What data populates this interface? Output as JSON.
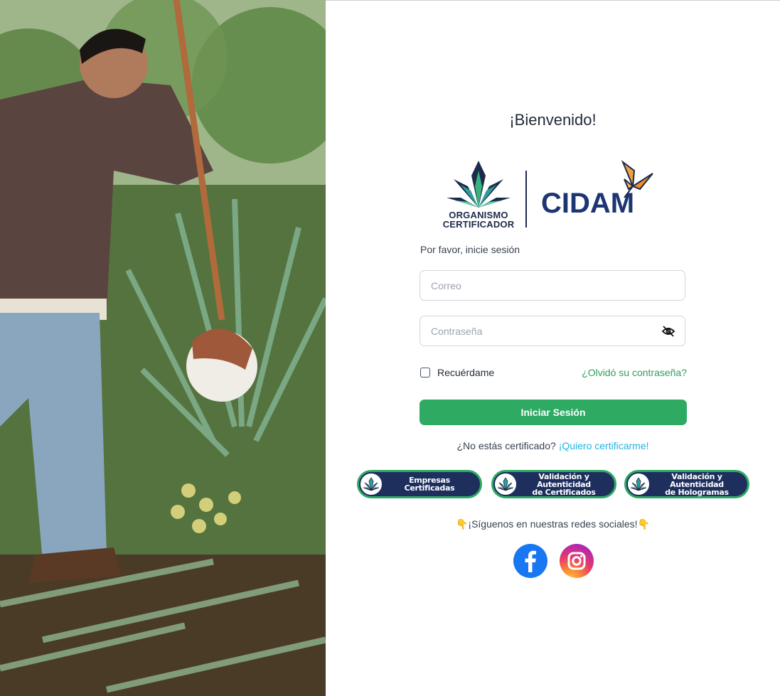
{
  "welcome": "¡Bienvenido!",
  "logo": {
    "org_line1": "ORGANISMO",
    "org_line2": "CERTIFICADOR",
    "brand": "CIDAM"
  },
  "subtitle": "Por favor, inicie sesión",
  "form": {
    "email_placeholder": "Correo",
    "password_placeholder": "Contraseña",
    "remember_label": "Recuérdame",
    "forgot_link": "¿Olvidó su contraseña?",
    "submit_label": "Iniciar Sesión"
  },
  "register": {
    "question": "¿No estás certificado?",
    "link": "¡Quiero certificarme!"
  },
  "quick_links": [
    {
      "line1": "Empresas Certificadas",
      "line2": ""
    },
    {
      "line1": "Validación y Autenticidad",
      "line2": "de Certificados"
    },
    {
      "line1": "Validación y Autenticidad",
      "line2": "de Hologramas"
    }
  ],
  "social": {
    "label": "¡Síguenos en nuestras redes sociales!",
    "hand_glyph": "👇"
  },
  "colors": {
    "primary_green": "#2eaa63",
    "navy": "#1e2f5e",
    "link_blue": "#1fb3e6"
  },
  "icons": [
    "eye-slash-icon",
    "agave-logo-icon",
    "butterfly-icon",
    "facebook-icon",
    "instagram-icon"
  ]
}
